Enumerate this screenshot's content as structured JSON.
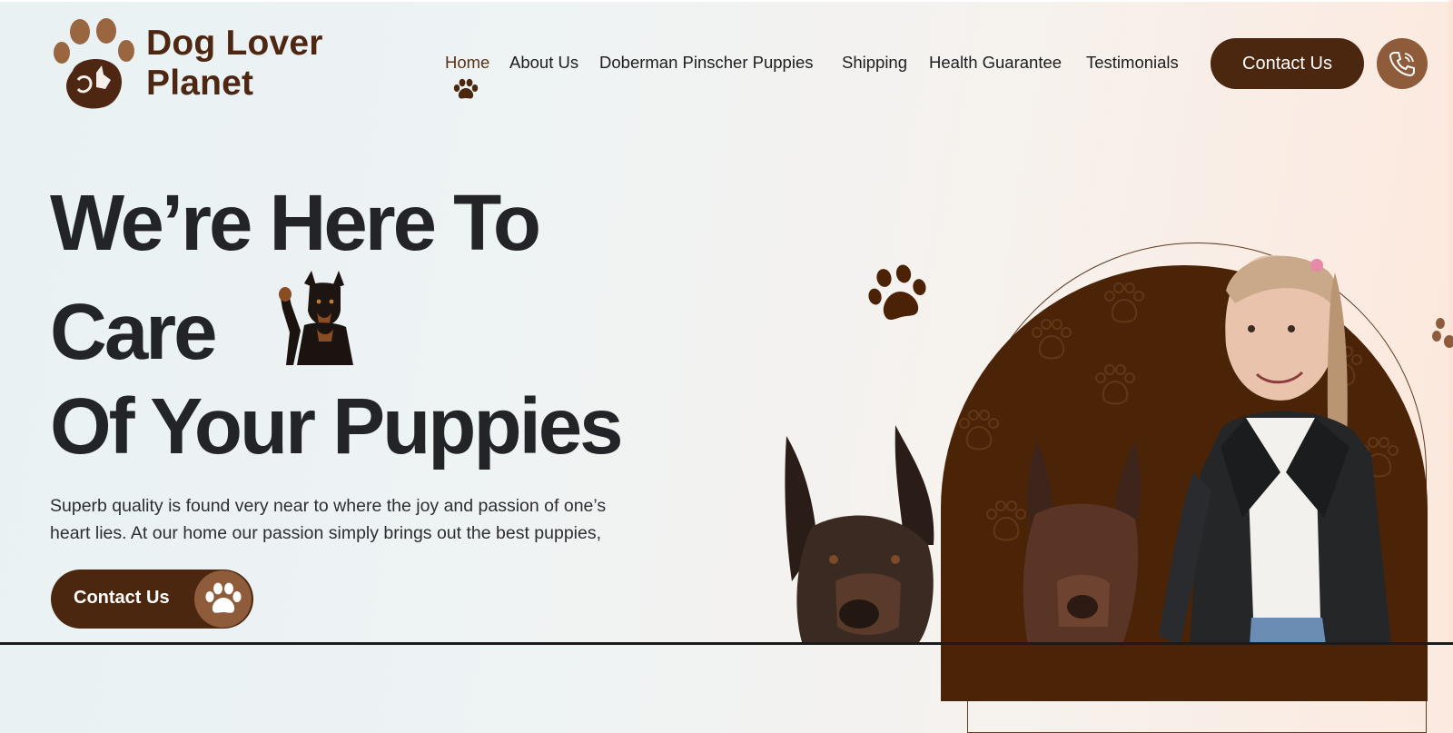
{
  "brand": {
    "name_line1": "Dog Lover",
    "name_line2": "Planet"
  },
  "nav": {
    "items": [
      {
        "label": "Home",
        "active": true
      },
      {
        "label": "About Us"
      },
      {
        "label": "Doberman Pinscher Puppies"
      },
      {
        "label": "Shipping"
      },
      {
        "label": "Health Guarantee"
      },
      {
        "label": "Testimonials"
      }
    ],
    "contact_label": "Contact Us"
  },
  "hero": {
    "line1": "We’re Here To",
    "line2": "Care",
    "line3": "Of Your Puppies",
    "subtitle_line1": "Superb quality is found very near to where the joy and passion of one’s",
    "subtitle_line2": "heart lies. At our home our passion simply brings out the best puppies,",
    "cta_label": "Contact Us"
  },
  "icons": {
    "logo": "paw-dog-logo-icon",
    "nav_active": "paw-icon",
    "phone": "phone-icon",
    "cta": "paw-icon"
  },
  "colors": {
    "brand_brown": "#4c2710",
    "accent_brown": "#8e5b3b",
    "heading": "#222428"
  }
}
